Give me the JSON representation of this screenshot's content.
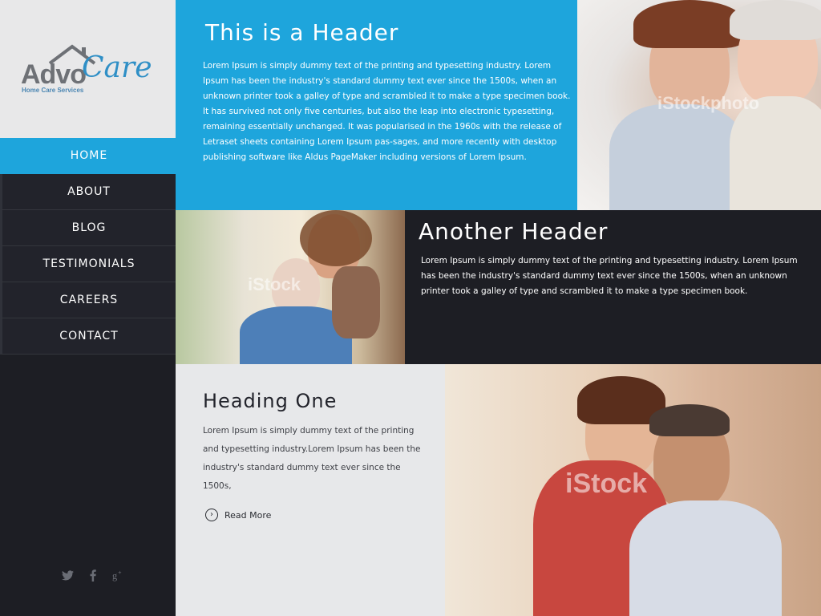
{
  "logo": {
    "word1": "Advo",
    "word2": "Care",
    "tagline": "Home Care Services"
  },
  "nav": {
    "items": [
      {
        "label": "HOME",
        "active": true
      },
      {
        "label": "ABOUT"
      },
      {
        "label": "BLOG"
      },
      {
        "label": "TESTIMONIALS"
      },
      {
        "label": "CAREERS"
      },
      {
        "label": "CONTACT"
      }
    ]
  },
  "social": {
    "icons": [
      "twitter-icon",
      "facebook-icon",
      "google-plus-icon"
    ]
  },
  "hero": {
    "title": "This is a Header",
    "body": "Lorem Ipsum is simply dummy text of the printing and typesetting industry. Lorem Ipsum has been the industry's standard dummy text ever since the 1500s, when an unknown printer took a galley of type and scrambled it to make a type specimen book. It has survived not only five centuries, but also the leap into electronic typesetting, remaining essentially unchanged. It was popularised in the 1960s with the release of Letraset sheets containing Lorem Ipsum pas-sages, and more recently with desktop publishing software like Aldus PageMaker including versions of Lorem Ipsum."
  },
  "section2": {
    "title": "Another Header",
    "body": "Lorem Ipsum is simply dummy text of the printing and typesetting industry. Lorem Ipsum has been the industry's standard dummy text ever since the 1500s, when an unknown printer took a galley of type and scrambled it to make a type specimen book."
  },
  "section3": {
    "title": "Heading One",
    "body": "Lorem Ipsum is simply dummy text of the printing and typesetting industry.Lorem Ipsum has been the industry's standard dummy text ever since the 1500s,",
    "read_more": "Read More"
  },
  "watermarks": {
    "photo1": "iStockphoto",
    "photo2": "iStock",
    "photo3": "iStock"
  },
  "colors": {
    "accent": "#1ea5dc",
    "dark": "#1d1e24",
    "light": "#e7e8ea"
  }
}
